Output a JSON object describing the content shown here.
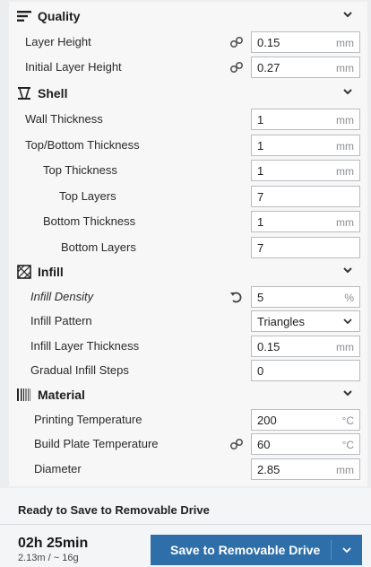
{
  "sections": {
    "quality": {
      "title": "Quality",
      "icon": "quality-lines-icon"
    },
    "shell": {
      "title": "Shell",
      "icon": "shell-icon"
    },
    "infill": {
      "title": "Infill",
      "icon": "infill-grid-icon"
    },
    "material": {
      "title": "Material",
      "icon": "material-bars-icon"
    }
  },
  "settings": {
    "layer_height": {
      "label": "Layer Height",
      "value": "0.15",
      "unit": "mm"
    },
    "initial_layer_height": {
      "label": "Initial Layer Height",
      "value": "0.27",
      "unit": "mm"
    },
    "wall_thickness": {
      "label": "Wall Thickness",
      "value": "1",
      "unit": "mm"
    },
    "top_bottom_thickness": {
      "label": "Top/Bottom Thickness",
      "value": "1",
      "unit": "mm"
    },
    "top_thickness": {
      "label": "Top Thickness",
      "value": "1",
      "unit": "mm"
    },
    "top_layers": {
      "label": "Top Layers",
      "value": "7"
    },
    "bottom_thickness": {
      "label": "Bottom Thickness",
      "value": "1",
      "unit": "mm"
    },
    "bottom_layers": {
      "label": "Bottom Layers",
      "value": "7"
    },
    "infill_density": {
      "label": "Infill Density",
      "value": "5",
      "unit": "%"
    },
    "infill_pattern": {
      "label": "Infill Pattern",
      "value": "Triangles"
    },
    "infill_layer_thickness": {
      "label": "Infill Layer Thickness",
      "value": "0.15",
      "unit": "mm"
    },
    "gradual_infill_steps": {
      "label": "Gradual Infill Steps",
      "value": "0"
    },
    "printing_temperature": {
      "label": "Printing Temperature",
      "value": "200",
      "unit": "°C"
    },
    "build_plate_temperature": {
      "label": "Build Plate Temperature",
      "value": "60",
      "unit": "°C"
    },
    "diameter": {
      "label": "Diameter",
      "value": "2.85",
      "unit": "mm"
    }
  },
  "footer": {
    "status": "Ready to Save to Removable Drive",
    "print_time": "02h 25min",
    "print_stats": "2.13m / ~ 16g",
    "save_label": "Save to Removable Drive"
  },
  "colors": {
    "accent": "#2f6fa9",
    "panel": "#f7f7f8",
    "field_border": "#b9bcc0"
  }
}
